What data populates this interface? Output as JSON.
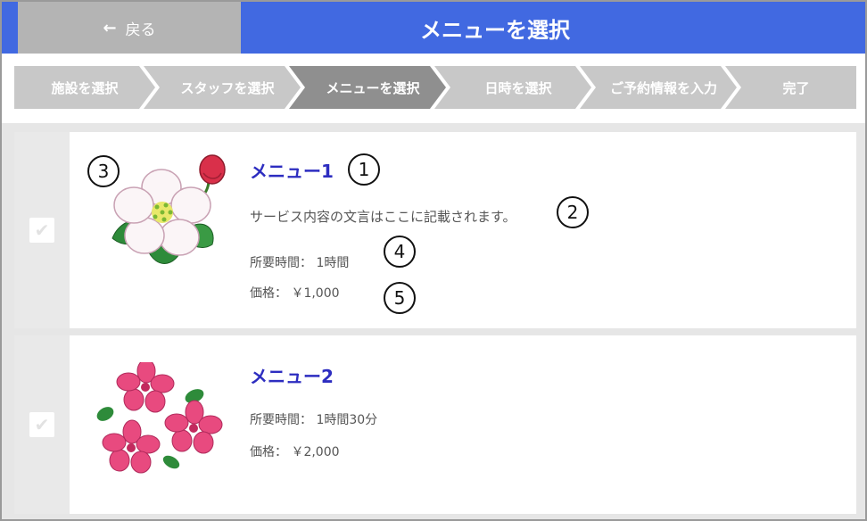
{
  "header": {
    "back_label": "戻る",
    "title": "メニューを選択"
  },
  "steps": [
    {
      "label": "施設を選択",
      "active": false
    },
    {
      "label": "スタッフを選択",
      "active": false
    },
    {
      "label": "メニューを選択",
      "active": true
    },
    {
      "label": "日時を選択",
      "active": false
    },
    {
      "label": "ご予約情報を入力",
      "active": false
    },
    {
      "label": "完了",
      "active": false
    }
  ],
  "menus": [
    {
      "name": "メニュー1",
      "description": "サービス内容の文言はここに記載されます。",
      "duration": "所要時間： 1時間",
      "price": "価格： ￥1,000",
      "image": "apple-blossom-illustration",
      "selected": false
    },
    {
      "name": "メニュー2",
      "duration": "所要時間： 1時間30分",
      "price": "価格： ￥2,000",
      "image": "azalea-illustration",
      "selected": false
    }
  ],
  "annotations": [
    "1",
    "2",
    "3",
    "4",
    "5"
  ],
  "colors": {
    "header_blue": "#4169e1",
    "back_gray": "#b4b4b4",
    "step_gray": "#c8c8c8",
    "step_active": "#8f8f8f",
    "menu_name": "#2d2dc0",
    "text": "#555555"
  }
}
